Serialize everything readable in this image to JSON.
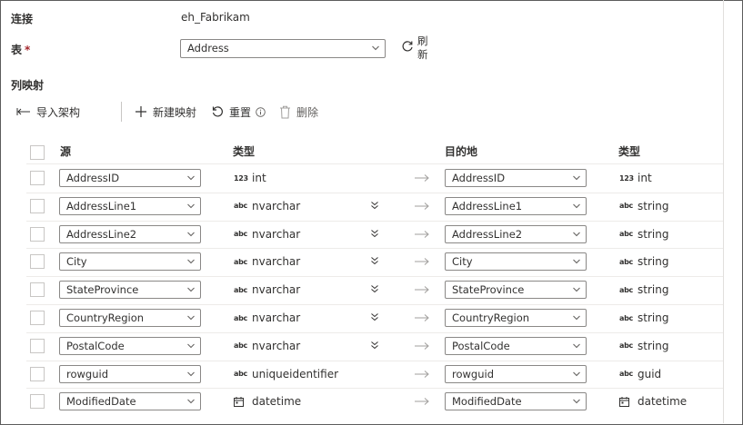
{
  "connection": {
    "label": "连接",
    "value": "eh_Fabrikam"
  },
  "table": {
    "label": "表",
    "required_mark": "*",
    "value": "Address",
    "refresh_label_1": "刷",
    "refresh_label_2": "新"
  },
  "section_title": "列映射",
  "toolbar": {
    "import_schema": "导入架构",
    "new_mapping": "新建映射",
    "reset": "重置",
    "delete": "删除"
  },
  "headers": {
    "source": "源",
    "source_type": "类型",
    "destination": "目的地",
    "destination_type": "类型"
  },
  "rows": [
    {
      "source": "AddressID",
      "source_type_icon": "123",
      "source_type": "int",
      "has_expander": false,
      "destination": "AddressID",
      "dest_type_icon": "123",
      "dest_type": "int"
    },
    {
      "source": "AddressLine1",
      "source_type_icon": "abc",
      "source_type": "nvarchar",
      "has_expander": true,
      "destination": "AddressLine1",
      "dest_type_icon": "abc",
      "dest_type": "string"
    },
    {
      "source": "AddressLine2",
      "source_type_icon": "abc",
      "source_type": "nvarchar",
      "has_expander": true,
      "destination": "AddressLine2",
      "dest_type_icon": "abc",
      "dest_type": "string"
    },
    {
      "source": "City",
      "source_type_icon": "abc",
      "source_type": "nvarchar",
      "has_expander": true,
      "destination": "City",
      "dest_type_icon": "abc",
      "dest_type": "string"
    },
    {
      "source": "StateProvince",
      "source_type_icon": "abc",
      "source_type": "nvarchar",
      "has_expander": true,
      "destination": "StateProvince",
      "dest_type_icon": "abc",
      "dest_type": "string"
    },
    {
      "source": "CountryRegion",
      "source_type_icon": "abc",
      "source_type": "nvarchar",
      "has_expander": true,
      "destination": "CountryRegion",
      "dest_type_icon": "abc",
      "dest_type": "string"
    },
    {
      "source": "PostalCode",
      "source_type_icon": "abc",
      "source_type": "nvarchar",
      "has_expander": true,
      "destination": "PostalCode",
      "dest_type_icon": "abc",
      "dest_type": "string"
    },
    {
      "source": "rowguid",
      "source_type_icon": "abc",
      "source_type": "uniqueidentifier",
      "has_expander": false,
      "destination": "rowguid",
      "dest_type_icon": "abc",
      "dest_type": "guid"
    },
    {
      "source": "ModifiedDate",
      "source_type_icon": "calendar",
      "source_type": "datetime",
      "has_expander": false,
      "destination": "ModifiedDate",
      "dest_type_icon": "calendar",
      "dest_type": "datetime"
    }
  ],
  "colors": {
    "accent": "#0078d4",
    "required": "#a4262c",
    "border": "#8a8886",
    "text": "#323130"
  }
}
